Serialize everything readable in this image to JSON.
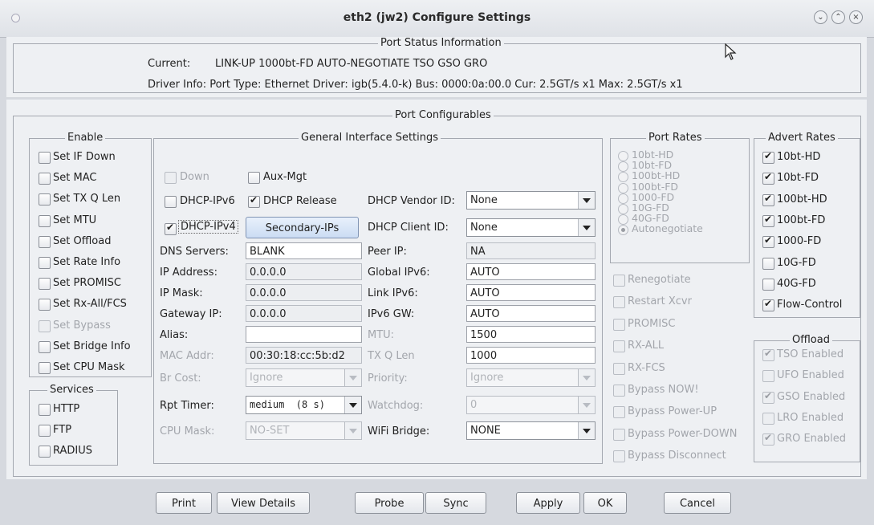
{
  "window": {
    "title": "eth2  (jw2) Configure Settings",
    "buttons": [
      "minimize",
      "maximize",
      "close"
    ]
  },
  "port_status": {
    "title": "Port Status Information",
    "current_label": "Current:",
    "current_value": "LINK-UP 1000bt-FD AUTO-NEGOTIATE TSO GSO GRO",
    "driver_info": "Driver Info: Port Type: Ethernet   Driver: igb(5.4.0-k)  Bus: 0000:0a:00.0  Cur: 2.5GT/s x1  Max: 2.5GT/s x1"
  },
  "port_configurables": {
    "title": "Port Configurables"
  },
  "enable": {
    "title": "Enable",
    "items": [
      {
        "label": "Set IF Down",
        "checked": false,
        "enabled": true
      },
      {
        "label": "Set MAC",
        "checked": false,
        "enabled": true
      },
      {
        "label": "Set TX Q Len",
        "checked": false,
        "enabled": true
      },
      {
        "label": "Set MTU",
        "checked": false,
        "enabled": true
      },
      {
        "label": "Set Offload",
        "checked": false,
        "enabled": true
      },
      {
        "label": "Set Rate Info",
        "checked": false,
        "enabled": true
      },
      {
        "label": "Set PROMISC",
        "checked": false,
        "enabled": true
      },
      {
        "label": "Set Rx-All/FCS",
        "checked": false,
        "enabled": true
      },
      {
        "label": "Set Bypass",
        "checked": false,
        "enabled": false
      },
      {
        "label": "Set Bridge Info",
        "checked": false,
        "enabled": true
      },
      {
        "label": "Set CPU Mask",
        "checked": false,
        "enabled": true
      }
    ]
  },
  "services": {
    "title": "Services",
    "items": [
      {
        "label": "HTTP",
        "checked": false
      },
      {
        "label": "FTP",
        "checked": false
      },
      {
        "label": "RADIUS",
        "checked": false
      }
    ]
  },
  "general": {
    "title": "General Interface Settings",
    "down": "Down",
    "aux_mgt": "Aux-Mgt",
    "dhcp_ipv6": "DHCP-IPv6",
    "dhcp_release": "DHCP Release",
    "dhcp_ipv4": "DHCP-IPv4",
    "secondary_ips": "Secondary-IPs",
    "dhcp_vendor_id_label": "DHCP Vendor ID:",
    "dhcp_vendor_id": "None",
    "dhcp_client_id_label": "DHCP Client ID:",
    "dhcp_client_id": "None",
    "dns_label": "DNS Servers:",
    "dns": "BLANK",
    "peer_ip_label": "Peer IP:",
    "peer_ip": "NA",
    "ip_label": "IP Address:",
    "ip": "0.0.0.0",
    "global_ipv6_label": "Global IPv6:",
    "global_ipv6": "AUTO",
    "mask_label": "IP Mask:",
    "mask": "0.0.0.0",
    "link_ipv6_label": "Link IPv6:",
    "link_ipv6": "AUTO",
    "gw_label": "Gateway IP:",
    "gw": "0.0.0.0",
    "ipv6_gw_label": "IPv6 GW:",
    "ipv6_gw": "AUTO",
    "alias_label": "Alias:",
    "alias": "",
    "mtu_label": "MTU:",
    "mtu": "1500",
    "mac_label": "MAC Addr:",
    "mac": "00:30:18:cc:5b:d2",
    "txq_label": "TX Q Len",
    "txq": "1000",
    "brcost_label": "Br Cost:",
    "brcost": "Ignore",
    "priority_label": "Priority:",
    "priority": "Ignore",
    "rpt_label": "Rpt Timer:",
    "rpt": "medium  (8 s)",
    "watchdog_label": "Watchdog:",
    "watchdog": "0",
    "cpumask_label": "CPU Mask:",
    "cpumask": "NO-SET",
    "wifi_label": "WiFi Bridge:",
    "wifi": "NONE"
  },
  "port_rates": {
    "title": "Port Rates",
    "items": [
      "10bt-HD",
      "10bt-FD",
      "100bt-HD",
      "100bt-FD",
      "1000-FD",
      "10G-FD",
      "40G-FD",
      "Autonegotiate"
    ],
    "selected": "Autonegotiate"
  },
  "misc": {
    "items": [
      "Renegotiate",
      "Restart Xcvr",
      "PROMISC",
      "RX-ALL",
      "RX-FCS",
      "Bypass NOW!",
      "Bypass Power-UP",
      "Bypass Power-DOWN",
      "Bypass Disconnect"
    ]
  },
  "advert_rates": {
    "title": "Advert Rates",
    "items": [
      {
        "label": "10bt-HD",
        "checked": true
      },
      {
        "label": "10bt-FD",
        "checked": true
      },
      {
        "label": "100bt-HD",
        "checked": true
      },
      {
        "label": "100bt-FD",
        "checked": true
      },
      {
        "label": "1000-FD",
        "checked": true
      },
      {
        "label": "10G-FD",
        "checked": false
      },
      {
        "label": "40G-FD",
        "checked": false
      },
      {
        "label": "Flow-Control",
        "checked": true
      }
    ]
  },
  "offload": {
    "title": "Offload",
    "items": [
      {
        "label": "TSO Enabled",
        "checked": true
      },
      {
        "label": "UFO Enabled",
        "checked": false
      },
      {
        "label": "GSO Enabled",
        "checked": true
      },
      {
        "label": "LRO Enabled",
        "checked": false
      },
      {
        "label": "GRO Enabled",
        "checked": true
      }
    ]
  },
  "footer": {
    "buttons": [
      "Print",
      "View Details",
      "Probe",
      "Sync",
      "Apply",
      "OK",
      "Cancel"
    ]
  }
}
